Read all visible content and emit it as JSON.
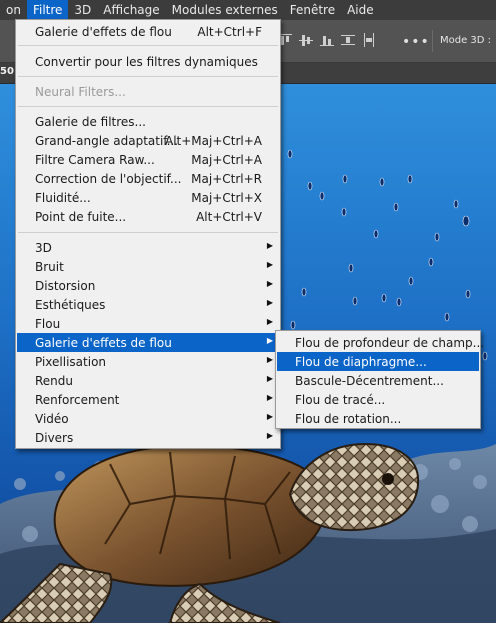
{
  "menubar": {
    "items": [
      {
        "label": "on",
        "active": false
      },
      {
        "label": "Filtre",
        "active": true
      },
      {
        "label": "3D",
        "active": false
      },
      {
        "label": "Affichage",
        "active": false
      },
      {
        "label": "Modules externes",
        "active": false
      },
      {
        "label": "Fenêtre",
        "active": false
      },
      {
        "label": "Aide",
        "active": false
      }
    ]
  },
  "options_bar": {
    "more_icon": "more-horizontal-icon",
    "more_glyph": "•••",
    "mode_3d_label": "Mode 3D :"
  },
  "tab_strip": {
    "zoom_partial": "50"
  },
  "filter_menu": {
    "last_filter": {
      "label": "Galerie d'effets de flou",
      "shortcut": "Alt+Ctrl+F"
    },
    "convert_smart": {
      "label": "Convertir pour les filtres dynamiques"
    },
    "neural": {
      "label": "Neural Filters...",
      "disabled": true
    },
    "filter_gallery": {
      "label": "Galerie de filtres..."
    },
    "adaptive_wide_angle": {
      "label": "Grand-angle adaptatif...",
      "shortcut": "Alt+Maj+Ctrl+A"
    },
    "camera_raw": {
      "label": "Filtre Camera Raw...",
      "shortcut": "Maj+Ctrl+A"
    },
    "lens_correction": {
      "label": "Correction de l'objectif...",
      "shortcut": "Maj+Ctrl+R"
    },
    "liquify": {
      "label": "Fluidité...",
      "shortcut": "Maj+Ctrl+X"
    },
    "vanishing_point": {
      "label": "Point de fuite...",
      "shortcut": "Alt+Ctrl+V"
    },
    "sub_3d": {
      "label": "3D"
    },
    "noise": {
      "label": "Bruit"
    },
    "distort": {
      "label": "Distorsion"
    },
    "stylize": {
      "label": "Esthétiques"
    },
    "blur": {
      "label": "Flou"
    },
    "blur_gallery": {
      "label": "Galerie d'effets de flou",
      "highlighted": true
    },
    "pixelate": {
      "label": "Pixellisation"
    },
    "render": {
      "label": "Rendu"
    },
    "sharpen": {
      "label": "Renforcement"
    },
    "video": {
      "label": "Vidéo"
    },
    "other": {
      "label": "Divers"
    },
    "submenu_arrow": "▶"
  },
  "blur_gallery_submenu": {
    "field_blur": {
      "label": "Flou de profondeur de champ..."
    },
    "iris_blur": {
      "label": "Flou de diaphragme...",
      "highlighted": true
    },
    "tilt_shift": {
      "label": "Bascule-Décentrement..."
    },
    "path_blur": {
      "label": "Flou de tracé..."
    },
    "spin_blur": {
      "label": "Flou de rotation..."
    }
  },
  "colors": {
    "menubar_bg": "#3c3c3c",
    "highlight": "#0b64c8",
    "menu_bg": "#f0f0f0",
    "ocean_top": "#1f7fd0",
    "ocean_bottom": "#0a3c8a"
  },
  "canvas": {
    "image_content": "sea-turtle-underwater-photo"
  }
}
